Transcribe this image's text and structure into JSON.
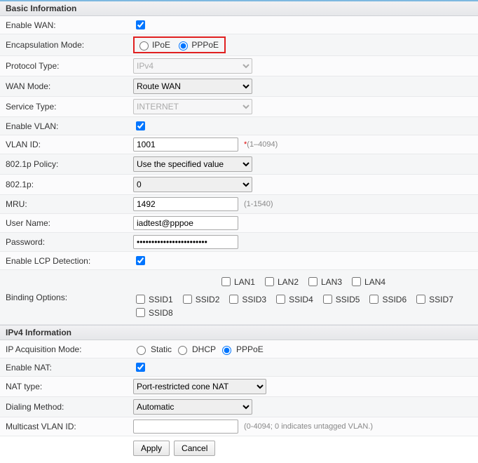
{
  "sections": {
    "basic": "Basic Information",
    "ipv4": "IPv4 Information"
  },
  "basic": {
    "enable_wan": {
      "label": "Enable WAN:",
      "checked": true
    },
    "encap": {
      "label": "Encapsulation Mode:",
      "opt_ipoe": "IPoE",
      "opt_pppoe": "PPPoE",
      "selected": "pppoe"
    },
    "protocol": {
      "label": "Protocol Type:",
      "value": "IPv4",
      "disabled": true
    },
    "wan_mode": {
      "label": "WAN Mode:",
      "value": "Route WAN"
    },
    "service": {
      "label": "Service Type:",
      "value": "INTERNET",
      "disabled": true
    },
    "enable_vlan": {
      "label": "Enable VLAN:",
      "checked": true
    },
    "vlan_id": {
      "label": "VLAN ID:",
      "value": "1001",
      "hint": "(1–4094)",
      "req": "*"
    },
    "dot1p_pol": {
      "label": "802.1p Policy:",
      "value": "Use the specified value"
    },
    "dot1p": {
      "label": "802.1p:",
      "value": "0"
    },
    "mru": {
      "label": "MRU:",
      "value": "1492",
      "hint": "(1-1540)"
    },
    "user": {
      "label": "User Name:",
      "value": "iadtest@pppoe"
    },
    "pass": {
      "label": "Password:",
      "value": "••••••••••••••••••••••••"
    },
    "lcp": {
      "label": "Enable LCP Detection:",
      "checked": true
    },
    "binding": {
      "label": "Binding Options:",
      "lan": [
        "LAN1",
        "LAN2",
        "LAN3",
        "LAN4"
      ],
      "ssid": [
        "SSID1",
        "SSID2",
        "SSID3",
        "SSID4",
        "SSID5",
        "SSID6",
        "SSID7",
        "SSID8"
      ]
    }
  },
  "ipv4": {
    "ip_acq": {
      "label": "IP Acquisition Mode:",
      "opt_static": "Static",
      "opt_dhcp": "DHCP",
      "opt_pppoe": "PPPoE",
      "selected": "pppoe"
    },
    "nat": {
      "label": "Enable NAT:",
      "checked": true
    },
    "nat_type": {
      "label": "NAT type:",
      "value": "Port-restricted cone NAT"
    },
    "dial": {
      "label": "Dialing Method:",
      "value": "Automatic"
    },
    "mvlan": {
      "label": "Multicast VLAN ID:",
      "value": "",
      "hint": "(0-4094; 0 indicates untagged VLAN.)"
    }
  },
  "buttons": {
    "apply": "Apply",
    "cancel": "Cancel"
  }
}
